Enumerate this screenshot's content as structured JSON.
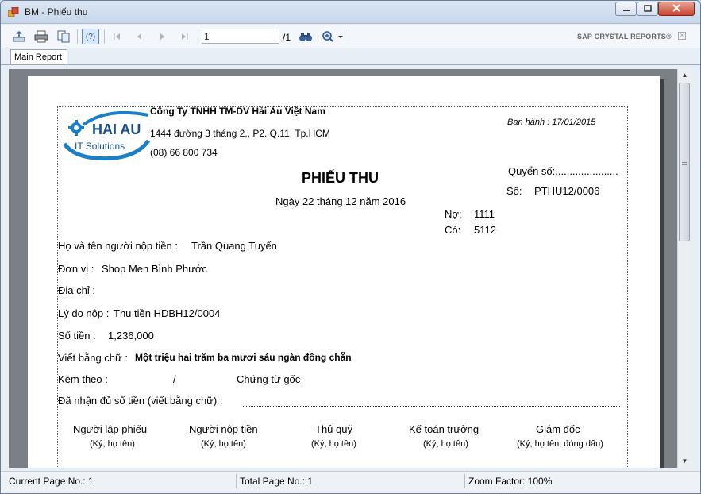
{
  "window": {
    "title": "BM - Phiếu thu"
  },
  "toolbar": {
    "help_label": "(?)",
    "page_input": "1",
    "page_total": "/1",
    "brand": "SAP CRYSTAL REPORTS®"
  },
  "tabs": [
    {
      "label": "Main Report"
    }
  ],
  "report": {
    "company_name": "Công Ty TNHH TM-DV Hải Âu Việt Nam",
    "address": "1444 đường 3 tháng 2,, P2. Q.11, Tp.HCM",
    "phone": "(08) 66 800 734",
    "logo_text": "HAI AU",
    "logo_sub": "IT Solutions",
    "issue_label": "Ban hành : 17/01/2015",
    "title": "PHIẾU THU",
    "date_text": "Ngày 22 tháng 12 năm 2016",
    "book_label": "Quyển số:......................",
    "number_label": "Số:",
    "number_value": "PTHU12/0006",
    "debit_label": "Nợ:",
    "debit_value": "1111",
    "credit_label": "Có:",
    "credit_value": "5112",
    "payer_label": "Họ và tên người nộp tiền :",
    "payer_value": "Trần Quang Tuyến",
    "unit_label": "Đơn vị :",
    "unit_value": "Shop Men Bình Phước",
    "address_label": "Địa chỉ :",
    "reason_label": "Lý do nộp :",
    "reason_value": "Thu tiền HDBH12/0004",
    "amount_label": "Số tiền :",
    "amount_value": "1,236,000",
    "words_label": "Viết bằng chữ :",
    "words_value": "Một triệu hai trăm ba mươi sáu ngàn đồng chẵn",
    "attach_label": "Kèm theo :",
    "attach_sep": "/",
    "attach_doc": "Chứng từ gốc",
    "received_label": "Đã nhận đủ số tiền (viết bằng chữ) :",
    "signatures": [
      {
        "title": "Người lập phiếu",
        "note": "(Ký, họ tên)"
      },
      {
        "title": "Người nộp tiền",
        "note": "(Ký, họ tên)"
      },
      {
        "title": "Thủ quỹ",
        "note": "(Ký, họ tên)"
      },
      {
        "title": "Kế toán trưởng",
        "note": "(Ký, họ tên)"
      },
      {
        "title": "Giám đốc",
        "note": "(Ký, họ tên, đóng dấu)"
      }
    ]
  },
  "status": {
    "current_page": "Current Page No.: 1",
    "total_page": "Total Page No.: 1",
    "zoom": "Zoom Factor: 100%"
  },
  "colors": {
    "logo_blue": "#1a7fc4",
    "logo_dark": "#1b4f8c"
  }
}
